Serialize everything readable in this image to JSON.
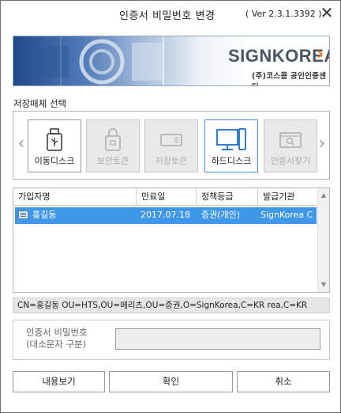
{
  "window": {
    "title": "인증서 비밀번호 변경",
    "version": "( Ver 2.3.1.3392 )",
    "close_glyph": "✕"
  },
  "banner": {
    "brand_name": "SignKorea",
    "brand_sub": "(주)코스콤 공인인증센터",
    "brand_color": "#f07a1a"
  },
  "storage": {
    "label": "저장매체 선택",
    "prev_glyph": "‹",
    "next_glyph": "›",
    "media": [
      {
        "label": "이동디스크",
        "icon": "usb-drive-icon",
        "state": "active"
      },
      {
        "label": "보안토큰",
        "icon": "security-token-icon",
        "state": "disabled"
      },
      {
        "label": "저장토큰",
        "icon": "storage-token-icon",
        "state": "disabled"
      },
      {
        "label": "하드디스크",
        "icon": "hard-disk-icon",
        "state": "selected"
      },
      {
        "label": "인증서찾기",
        "icon": "find-certificate-icon",
        "state": "disabled"
      }
    ]
  },
  "cert_table": {
    "columns": [
      "가입자명",
      "만료일",
      "정책등급",
      "발급기관"
    ],
    "rows": [
      {
        "name": "홍길동",
        "expiry": "2017.07.18",
        "policy": "증권(개인)",
        "issuer": "SignKorea C",
        "selected": true
      }
    ],
    "selected_color": "#3f97e8"
  },
  "subject_dn": "CN=홍길동 OU=HTS,OU=메리츠,OU=증권,O=SignKorea,C=KR rea,C=KR",
  "password": {
    "label_line1": "인증서 비밀번호",
    "label_line2": "(대소문자 구분)",
    "value": ""
  },
  "buttons": {
    "view": "내용보기",
    "confirm": "확인",
    "cancel": "취소"
  }
}
